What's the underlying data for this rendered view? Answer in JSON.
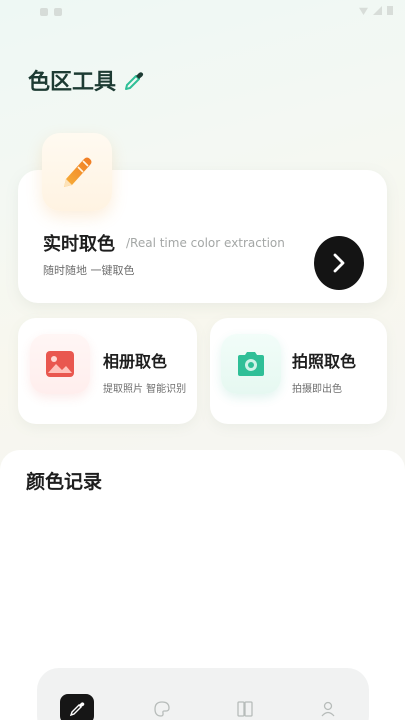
{
  "app": {
    "title": "色区工具",
    "title_icon": "eyedropper-icon"
  },
  "realtime": {
    "title": "实时取色",
    "subtitle_en": "/Real time color extraction",
    "desc": "随时随地 一键取色",
    "icon": "pencil-icon",
    "action_icon": "chevron-right-icon"
  },
  "album": {
    "title": "相册取色",
    "desc": "提取照片 智能识别",
    "icon": "image-icon",
    "color": "#e9574f"
  },
  "camera": {
    "title": "拍照取色",
    "desc": "拍摄即出色",
    "icon": "camera-icon",
    "color": "#2fbf97"
  },
  "history": {
    "title": "颜色记录"
  },
  "tabbar": {
    "tabs": [
      {
        "icon": "eyedropper-icon",
        "active": true
      },
      {
        "icon": "palette-icon",
        "active": false
      },
      {
        "icon": "swatch-book-icon",
        "active": false
      },
      {
        "icon": "user-icon",
        "active": false
      }
    ]
  },
  "colors": {
    "brand_title": "#1d3b33",
    "accent_orange": "#f29a2e",
    "dark_button": "#141414"
  }
}
